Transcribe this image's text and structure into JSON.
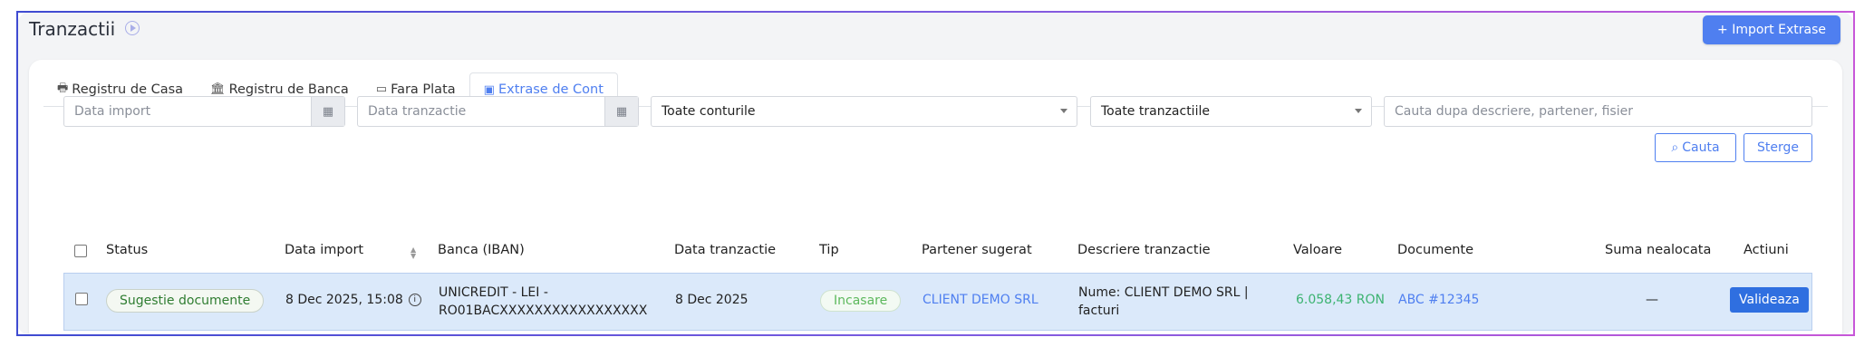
{
  "page": {
    "title": "Tranzactii",
    "import_button": "+ Import Extrase"
  },
  "tabs": [
    {
      "label": "Registru de Casa",
      "icon": "cash-register-icon"
    },
    {
      "label": "Registru de Banca",
      "icon": "bank-icon"
    },
    {
      "label": "Fara Plata",
      "icon": "window-icon"
    },
    {
      "label": "Extrase de Cont",
      "icon": "money-icon",
      "active": true
    }
  ],
  "filters": {
    "import_date_placeholder": "Data import",
    "transaction_date_placeholder": "Data tranzactie",
    "accounts_select": "Toate conturile",
    "transactions_select": "Toate tranzactiile",
    "search_placeholder": "Cauta dupa descriere, partener, fisier",
    "search_button": "Cauta",
    "clear_button": "Sterge"
  },
  "table": {
    "columns": [
      "Status",
      "Data import",
      "Banca (IBAN)",
      "Data tranzactie",
      "Tip",
      "Partener sugerat",
      "Descriere tranzactie",
      "Valoare",
      "Documente",
      "Suma nealocata",
      "Actiuni"
    ],
    "rows": [
      {
        "status": "Sugestie documente",
        "import_date": "8 Dec 2025, 15:08",
        "bank_line1": "UNICREDIT - LEI -",
        "bank_line2": "RO01BACXXXXXXXXXXXXXXXXX",
        "transaction_date": "8 Dec 2025",
        "type": "Incasare",
        "partner": "CLIENT DEMO SRL",
        "description_line1": "Nume: CLIENT DEMO SRL |",
        "description_line2": "facturi",
        "value": "6.058,43 RON",
        "documents": "ABC #12345",
        "unallocated": "—",
        "action": "Valideaza"
      }
    ]
  },
  "colors": {
    "accent": "#4f7ff0",
    "row_highlight": "#dbe9fa",
    "success": "#2f7d31",
    "value_green": "#3cb371"
  }
}
